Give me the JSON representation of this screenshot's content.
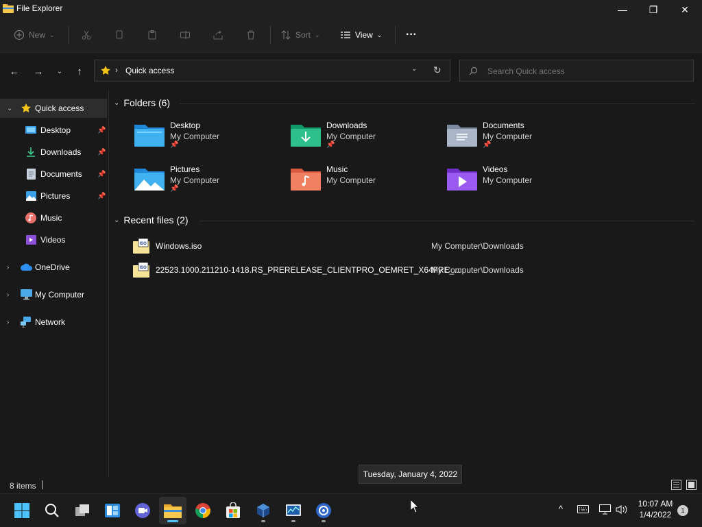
{
  "window": {
    "title": "File Explorer",
    "minimize": "—",
    "maximize": "❐",
    "close": "✕"
  },
  "toolbar": {
    "new_label": "New",
    "sort_label": "Sort",
    "view_label": "View",
    "more_label": "···"
  },
  "address": {
    "path": "Quick access",
    "separator": "›"
  },
  "search": {
    "placeholder": "Search Quick access"
  },
  "nav": {
    "quick_access": "Quick access",
    "pinned": [
      {
        "label": "Desktop"
      },
      {
        "label": "Downloads"
      },
      {
        "label": "Documents"
      },
      {
        "label": "Pictures"
      }
    ],
    "unpinned": [
      {
        "label": "Music"
      },
      {
        "label": "Videos"
      }
    ],
    "onedrive": "OneDrive",
    "my_computer": "My Computer",
    "network": "Network"
  },
  "folders": {
    "header": "Folders (6)",
    "items": [
      {
        "name": "Desktop",
        "location": "My Computer",
        "pinned": true
      },
      {
        "name": "Downloads",
        "location": "My Computer",
        "pinned": true
      },
      {
        "name": "Documents",
        "location": "My Computer",
        "pinned": true
      },
      {
        "name": "Pictures",
        "location": "My Computer",
        "pinned": true
      },
      {
        "name": "Music",
        "location": "My Computer",
        "pinned": false
      },
      {
        "name": "Videos",
        "location": "My Computer",
        "pinned": false
      }
    ]
  },
  "recent": {
    "header": "Recent files (2)",
    "items": [
      {
        "name": "Windows.iso",
        "location": "My Computer\\Downloads"
      },
      {
        "name": "22523.1000.211210-1418.RS_PRERELEASE_CLIENTPRO_OEMRET_X64FRE_...",
        "location": "My Computer\\Downloads"
      }
    ]
  },
  "status": {
    "items_count": "8 items"
  },
  "tooltip": {
    "text": "Tuesday, January 4, 2022"
  },
  "clock": {
    "time": "10:07 AM",
    "date": "1/4/2022",
    "notifications": "1"
  },
  "colors": {
    "accent": "#4cc2ff",
    "folder_yellow": "#f5c84c"
  }
}
